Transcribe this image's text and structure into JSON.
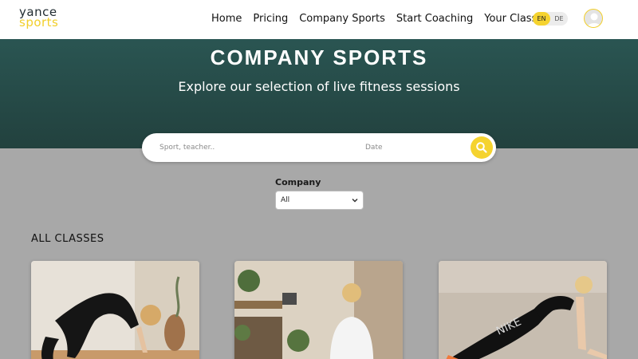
{
  "header": {
    "logo": {
      "line1": "yance",
      "line2": "sports"
    },
    "nav": [
      "Home",
      "Pricing",
      "Company Sports",
      "Start Coaching",
      "Your Classes"
    ],
    "lang": {
      "options": [
        "EN",
        "DE"
      ],
      "active": "EN"
    }
  },
  "hero": {
    "title": "COMPANY SPORTS",
    "subtitle": "Explore our selection of live fitness sessions"
  },
  "search": {
    "query_placeholder": "Sport, teacher..",
    "date_placeholder": "Date"
  },
  "filter": {
    "label": "Company",
    "selected": "All"
  },
  "classes": {
    "title": "ALL CLASSES"
  },
  "colors": {
    "accent": "#f5d32f",
    "hero": "#264a47",
    "page_bg": "#a8a8a8"
  }
}
